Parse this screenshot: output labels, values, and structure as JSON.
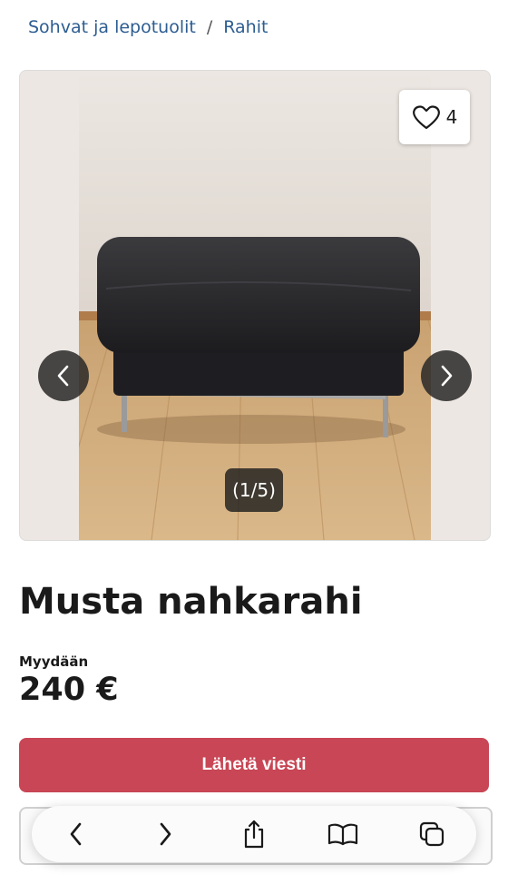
{
  "breadcrumb": {
    "items": [
      "Sohvat ja lepotuolit",
      "Rahit"
    ],
    "separator": "/"
  },
  "gallery": {
    "favorite_count": "4",
    "image_counter": "(1/5)",
    "image_subject": "black leather footstool on wooden floor"
  },
  "listing": {
    "title": "Musta nahkarahi",
    "sale_type": "Myydään",
    "price": "240 €"
  },
  "actions": {
    "send_message_label": "Lähetä viesti"
  },
  "browser_toolbar": {
    "icons": [
      "back-icon",
      "forward-icon",
      "share-icon",
      "bookmarks-icon",
      "tabs-icon"
    ]
  },
  "colors": {
    "link": "#2d5d91",
    "cta": "#c84655",
    "text": "#1a1a1a"
  }
}
